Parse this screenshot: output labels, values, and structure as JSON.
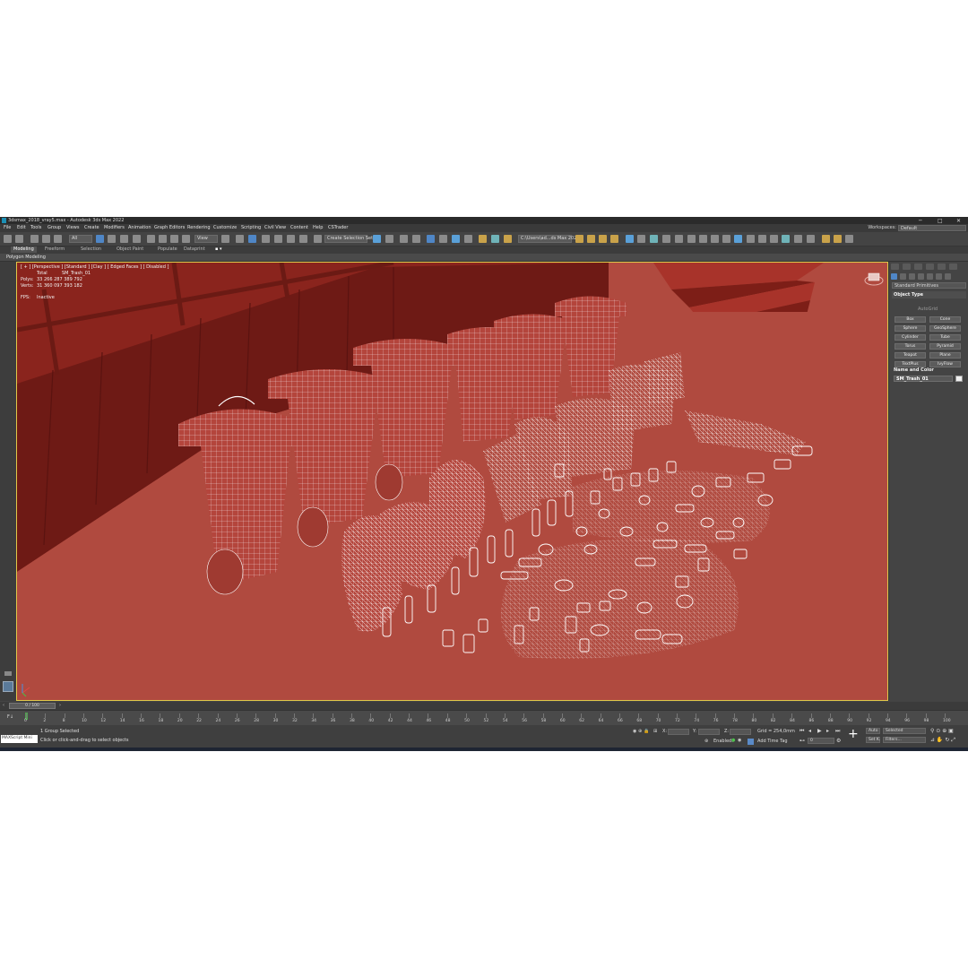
{
  "window": {
    "title": "3dsmax_2018_vray5.max - Autodesk 3ds Max 2022",
    "controls": [
      "─",
      "□",
      "✕"
    ]
  },
  "menu": {
    "items": [
      "File",
      "Edit",
      "Tools",
      "Group",
      "Views",
      "Create",
      "Modifiers",
      "Animation",
      "Graph Editors",
      "Rendering",
      "Customize",
      "Scripting",
      "Civil View",
      "Content",
      "Help",
      "CSTrader"
    ],
    "workspaces_label": "Workspaces:",
    "workspaces_value": "Default"
  },
  "toolbar": {
    "filter_value": "All",
    "view_value": "View",
    "selection_set_value": "Create Selection Set",
    "path_value": "C:\\Users\\ad...ds Max 202"
  },
  "ribbon": {
    "tabs": [
      "Modeling",
      "Freeform",
      "Selection",
      "Object Paint",
      "Populate",
      "Dataprint"
    ],
    "active_tab": "Modeling",
    "sub_label": "Polygon Modeling"
  },
  "viewport": {
    "label": "[ + ] [Perspective ] [Standard ] [Clay ] [ Edged Faces ]    [ Disabled ]",
    "stats": {
      "total_label": "Total",
      "object_name": "SM_Trash_01",
      "polys_label": "Polys:",
      "polys_value": "33 266 287  389 792",
      "verts_label": "Verts:",
      "verts_value": "31 360 097  393 182",
      "fps_label": "FPS:",
      "fps_value": "Inactive"
    }
  },
  "command_panel": {
    "category_value": "Standard Primitives",
    "object_type_title": "Object Type",
    "autogrid_label": "AutoGrid",
    "buttons": [
      "Box",
      "Cone",
      "Sphere",
      "GeoSphere",
      "Cylinder",
      "Tube",
      "Torus",
      "Pyramid",
      "Teapot",
      "Plane",
      "TextPlus",
      "IvyFlow"
    ],
    "name_color_title": "Name and Color",
    "object_name": "SM_Trash_01"
  },
  "timeline": {
    "frame_display": "0 / 100",
    "ticks": [
      "0",
      "2",
      "8",
      "10",
      "12",
      "14",
      "16",
      "18",
      "20",
      "22",
      "24",
      "26",
      "28",
      "30",
      "32",
      "34",
      "36",
      "38",
      "40",
      "42",
      "44",
      "46",
      "48",
      "50",
      "52",
      "54",
      "56",
      "58",
      "60",
      "62",
      "64",
      "66",
      "68",
      "70",
      "72",
      "74",
      "76",
      "78",
      "80",
      "82",
      "84",
      "86",
      "88",
      "90",
      "92",
      "94",
      "96",
      "98",
      "100"
    ]
  },
  "status": {
    "script_label": "MAXScript Mini",
    "selection_status": "1 Group Selected",
    "prompt": "Click or click-and-drag to select objects",
    "x_label": "X:",
    "y_label": "Y:",
    "z_label": "Z:",
    "grid": "Grid = 254,0mm",
    "enabled_label": "Enabled:",
    "add_time_tag": "Add Time Tag",
    "auto_label": "Auto",
    "selected_value": "Selected",
    "setk_label": "Set K.",
    "filters_label": "Filters...",
    "frame_value": "0"
  },
  "colors": {
    "viewport_bg": "#b04a3f",
    "wall": "#7d1d17",
    "floor_edge": "#6a1a16",
    "wire": "#ffffff",
    "accent": "#4f86c6"
  }
}
